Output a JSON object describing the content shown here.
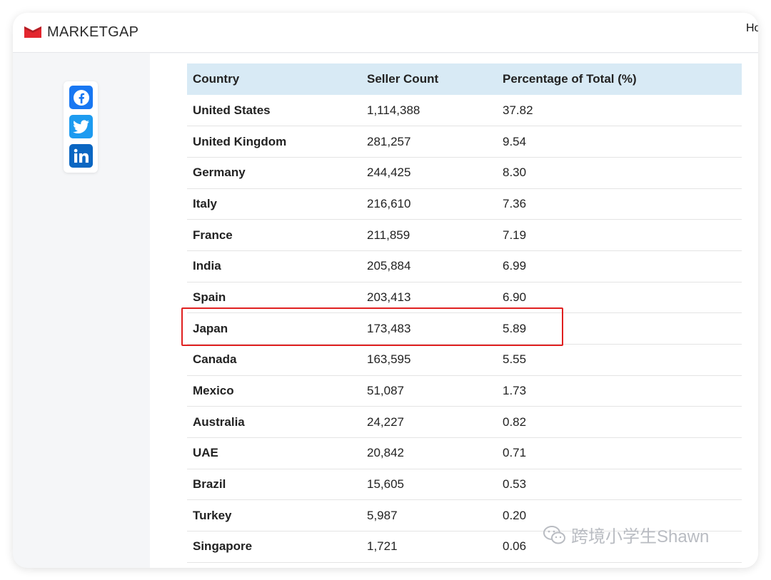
{
  "brand": {
    "name": "MARKETGAP",
    "color": "#e3262e"
  },
  "nav": {
    "home_label": "Ho"
  },
  "share": [
    {
      "name": "facebook",
      "icon": "facebook-icon",
      "color": "#1877f2"
    },
    {
      "name": "twitter",
      "icon": "twitter-icon",
      "color": "#1d9bf0"
    },
    {
      "name": "linkedin",
      "icon": "linkedin-icon",
      "color": "#0a66c2"
    }
  ],
  "table": {
    "headers": [
      "Country",
      "Seller Count",
      "Percentage of Total (%)"
    ],
    "rows": [
      {
        "country": "United States",
        "count": "1,114,388",
        "pct": "37.82"
      },
      {
        "country": "United Kingdom",
        "count": "281,257",
        "pct": "9.54"
      },
      {
        "country": "Germany",
        "count": "244,425",
        "pct": "8.30"
      },
      {
        "country": "Italy",
        "count": "216,610",
        "pct": "7.36"
      },
      {
        "country": "France",
        "count": "211,859",
        "pct": "7.19"
      },
      {
        "country": "India",
        "count": "205,884",
        "pct": "6.99"
      },
      {
        "country": "Spain",
        "count": "203,413",
        "pct": "6.90"
      },
      {
        "country": "Japan",
        "count": "173,483",
        "pct": "5.89"
      },
      {
        "country": "Canada",
        "count": "163,595",
        "pct": "5.55"
      },
      {
        "country": "Mexico",
        "count": "51,087",
        "pct": "1.73"
      },
      {
        "country": "Australia",
        "count": "24,227",
        "pct": "0.82"
      },
      {
        "country": "UAE",
        "count": "20,842",
        "pct": "0.71"
      },
      {
        "country": "Brazil",
        "count": "15,605",
        "pct": "0.53"
      },
      {
        "country": "Turkey",
        "count": "5,987",
        "pct": "0.20"
      },
      {
        "country": "Singapore",
        "count": "1,721",
        "pct": "0.06"
      }
    ],
    "highlighted_country": "Japan",
    "highlight_color": "#e02020",
    "header_bg": "#d8eaf5"
  },
  "watermark": {
    "text": "跨境小学生Shawn"
  }
}
